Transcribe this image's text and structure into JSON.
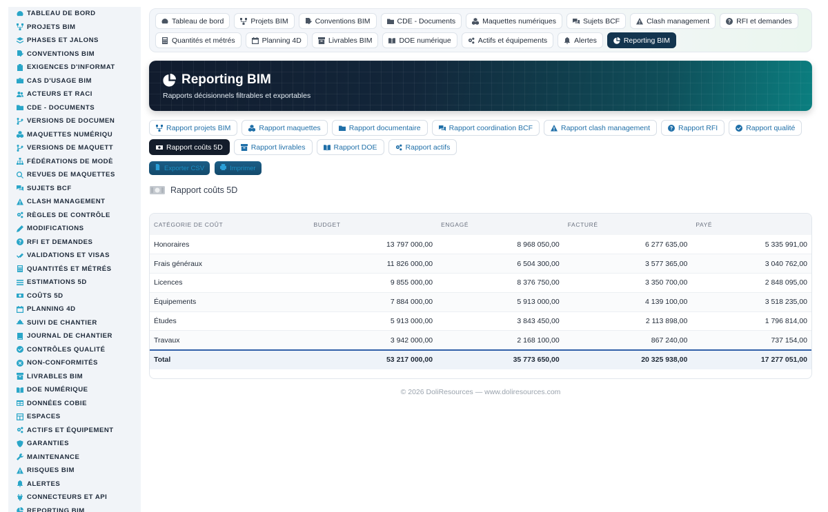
{
  "sidebar": {
    "items": [
      {
        "label": "TABLEAU DE BORD",
        "icon": "dashboard-icon"
      },
      {
        "label": "PROJETS BIM",
        "icon": "project-diagram-icon"
      },
      {
        "label": "PHASES ET JALONS",
        "icon": "layers-icon"
      },
      {
        "label": "CONVENTIONS BIM",
        "icon": "file-signature-icon"
      },
      {
        "label": "EXIGENCES D'INFORMAT",
        "icon": "clipboard-icon"
      },
      {
        "label": "CAS D'USAGE BIM",
        "icon": "briefcase-icon"
      },
      {
        "label": "ACTEURS ET RACI",
        "icon": "users-icon"
      },
      {
        "label": "CDE - DOCUMENTS",
        "icon": "folder-icon"
      },
      {
        "label": "VERSIONS DE DOCUMEN",
        "icon": "code-branch-icon"
      },
      {
        "label": "MAQUETTES NUMÉRIQU",
        "icon": "cubes-icon"
      },
      {
        "label": "VERSIONS DE MAQUETT",
        "icon": "code-branch-icon"
      },
      {
        "label": "FÉDÉRATIONS DE MODÈ",
        "icon": "sitemap-icon"
      },
      {
        "label": "REVUES DE MAQUETTES",
        "icon": "search-icon"
      },
      {
        "label": "SUJETS BCF",
        "icon": "comments-icon"
      },
      {
        "label": "CLASH MANAGEMENT",
        "icon": "warning-icon"
      },
      {
        "label": "RÈGLES DE CONTRÔLE",
        "icon": "cogs-icon"
      },
      {
        "label": "MODIFICATIONS",
        "icon": "edit-icon"
      },
      {
        "label": "RFI ET DEMANDES",
        "icon": "question-circle-icon"
      },
      {
        "label": "VALIDATIONS ET VISAS",
        "icon": "check-double-icon"
      },
      {
        "label": "QUANTITÉS ET MÉTRÉS",
        "icon": "calculator-icon"
      },
      {
        "label": "ESTIMATIONS 5D",
        "icon": "list-icon"
      },
      {
        "label": "COÛTS 5D",
        "icon": "money-icon"
      },
      {
        "label": "PLANNING 4D",
        "icon": "calendar-icon"
      },
      {
        "label": "SUIVI DE CHANTIER",
        "icon": "hard-hat-icon"
      },
      {
        "label": "JOURNAL DE CHANTIER",
        "icon": "book-icon"
      },
      {
        "label": "CONTRÔLES QUALITÉ",
        "icon": "check-circle-icon"
      },
      {
        "label": "NON-CONFORMITÉS",
        "icon": "times-circle-icon"
      },
      {
        "label": "LIVRABLES BIM",
        "icon": "box-icon"
      },
      {
        "label": "DOE NUMÉRIQUE",
        "icon": "book-open-icon"
      },
      {
        "label": "DONNÉES COBIE",
        "icon": "table-icon"
      },
      {
        "label": "ESPACES",
        "icon": "layout-icon"
      },
      {
        "label": "ACTIFS ET ÉQUIPEMENT",
        "icon": "cogs-icon"
      },
      {
        "label": "GARANTIES",
        "icon": "shield-icon"
      },
      {
        "label": "MAINTENANCE",
        "icon": "wrench-icon"
      },
      {
        "label": "RISQUES BIM",
        "icon": "warning-icon"
      },
      {
        "label": "ALERTES",
        "icon": "bell-icon"
      },
      {
        "label": "CONNECTEURS ET API",
        "icon": "plug-icon"
      },
      {
        "label": "REPORTING BIM",
        "icon": "chart-pie-icon"
      }
    ]
  },
  "nav": {
    "row1": [
      {
        "label": "Tableau de bord",
        "icon": "dashboard-icon"
      },
      {
        "label": "Projets BIM",
        "icon": "project-diagram-icon"
      },
      {
        "label": "Conventions BIM",
        "icon": "file-signature-icon"
      },
      {
        "label": "CDE - Documents",
        "icon": "folder-icon"
      },
      {
        "label": "Maquettes numériques",
        "icon": "cubes-icon"
      },
      {
        "label": "Sujets BCF",
        "icon": "comments-icon"
      },
      {
        "label": "Clash management",
        "icon": "warning-icon"
      },
      {
        "label": "RFI et demandes",
        "icon": "question-circle-icon"
      }
    ],
    "row2": [
      {
        "label": "Quantités et métrés",
        "icon": "calculator-icon"
      },
      {
        "label": "Planning 4D",
        "icon": "calendar-icon"
      },
      {
        "label": "Livrables BIM",
        "icon": "box-icon"
      },
      {
        "label": "DOE numérique",
        "icon": "book-open-icon"
      },
      {
        "label": "Actifs et équipements",
        "icon": "cogs-icon"
      },
      {
        "label": "Alertes",
        "icon": "bell-icon"
      },
      {
        "label": "Reporting BIM",
        "icon": "chart-pie-icon",
        "active": true
      }
    ]
  },
  "hero": {
    "title": "Reporting BIM",
    "subtitle": "Rapports décisionnels filtrables et exportables"
  },
  "reports": {
    "row1": [
      {
        "label": "Rapport projets BIM",
        "icon": "project-diagram-icon"
      },
      {
        "label": "Rapport maquettes",
        "icon": "cubes-icon"
      },
      {
        "label": "Rapport documentaire",
        "icon": "folder-icon"
      },
      {
        "label": "Rapport coordination BCF",
        "icon": "comments-icon"
      },
      {
        "label": "Rapport clash management",
        "icon": "warning-icon"
      },
      {
        "label": "Rapport RFI",
        "icon": "question-circle-icon"
      },
      {
        "label": "Rapport qualité",
        "icon": "check-circle-icon"
      }
    ],
    "row2": [
      {
        "label": "Rapport coûts 5D",
        "icon": "money-icon",
        "active": true
      },
      {
        "label": "Rapport livrables",
        "icon": "box-icon"
      },
      {
        "label": "Rapport DOE",
        "icon": "book-open-icon"
      },
      {
        "label": "Rapport actifs",
        "icon": "cogs-icon"
      }
    ]
  },
  "actions": {
    "export_label": "Exporter CSV",
    "print_label": "Imprimer"
  },
  "report": {
    "heading": "Rapport coûts 5D",
    "columns": [
      "CATÉGORIE DE COÛT",
      "BUDGET",
      "ENGAGÉ",
      "FACTURÉ",
      "PAYÉ"
    ],
    "rows": [
      [
        "Honoraires",
        "13 797 000,00",
        "8 968 050,00",
        "6 277 635,00",
        "5 335 991,00"
      ],
      [
        "Frais généraux",
        "11 826 000,00",
        "6 504 300,00",
        "3 577 365,00",
        "3 040 762,00"
      ],
      [
        "Licences",
        "9 855 000,00",
        "8 376 750,00",
        "3 350 700,00",
        "2 848 095,00"
      ],
      [
        "Équipements",
        "7 884 000,00",
        "5 913 000,00",
        "4 139 100,00",
        "3 518 235,00"
      ],
      [
        "Études",
        "5 913 000,00",
        "3 843 450,00",
        "2 113 898,00",
        "1 796 814,00"
      ],
      [
        "Travaux",
        "3 942 000,00",
        "2 168 100,00",
        "867 240,00",
        "737 154,00"
      ]
    ],
    "total": [
      "Total",
      "53 217 000,00",
      "35 773 650,00",
      "20 325 938,00",
      "17 277 051,00"
    ]
  },
  "footer": {
    "text": "© 2026 DoliResources — www.doliresources.com"
  },
  "colors": {
    "accent": "#2aa6c8",
    "active_nav": "#13354f",
    "active_report": "#141d2b",
    "link": "#1f6fa8",
    "total_border": "#2f5fa8"
  }
}
